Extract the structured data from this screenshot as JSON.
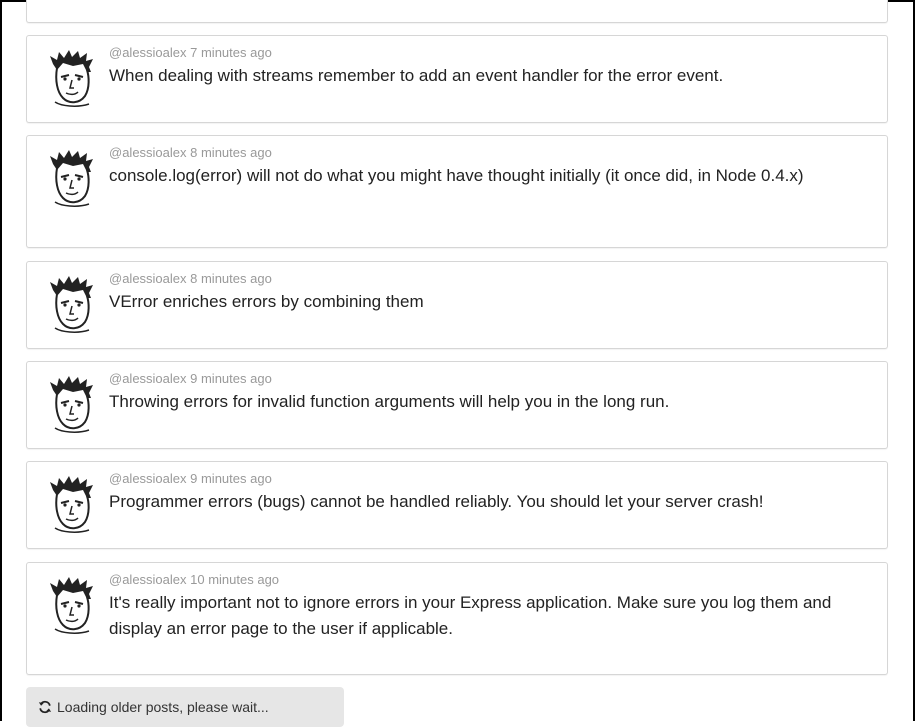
{
  "posts": [
    {
      "handle": "@alessioalex",
      "time": "7 minutes ago",
      "text": "When dealing with streams remember to add an event handler for the error event."
    },
    {
      "handle": "@alessioalex",
      "time": "8 minutes ago",
      "text": "console.log(error) will not do what you might have thought initially (it once did, in Node 0.4.x)"
    },
    {
      "handle": "@alessioalex",
      "time": "8 minutes ago",
      "text": "VError enriches errors by combining them"
    },
    {
      "handle": "@alessioalex",
      "time": "9 minutes ago",
      "text": "Throwing errors for invalid function arguments will help you in the long run."
    },
    {
      "handle": "@alessioalex",
      "time": "9 minutes ago",
      "text": "Programmer errors (bugs) cannot be handled reliably. You should let your server crash!"
    },
    {
      "handle": "@alessioalex",
      "time": "10 minutes ago",
      "text": "It's really important not to ignore errors in your Express application. Make sure you log them and display an error page to the user if applicable."
    }
  ],
  "loading": {
    "label": "Loading older posts, please wait...",
    "icon": "refresh-icon"
  }
}
